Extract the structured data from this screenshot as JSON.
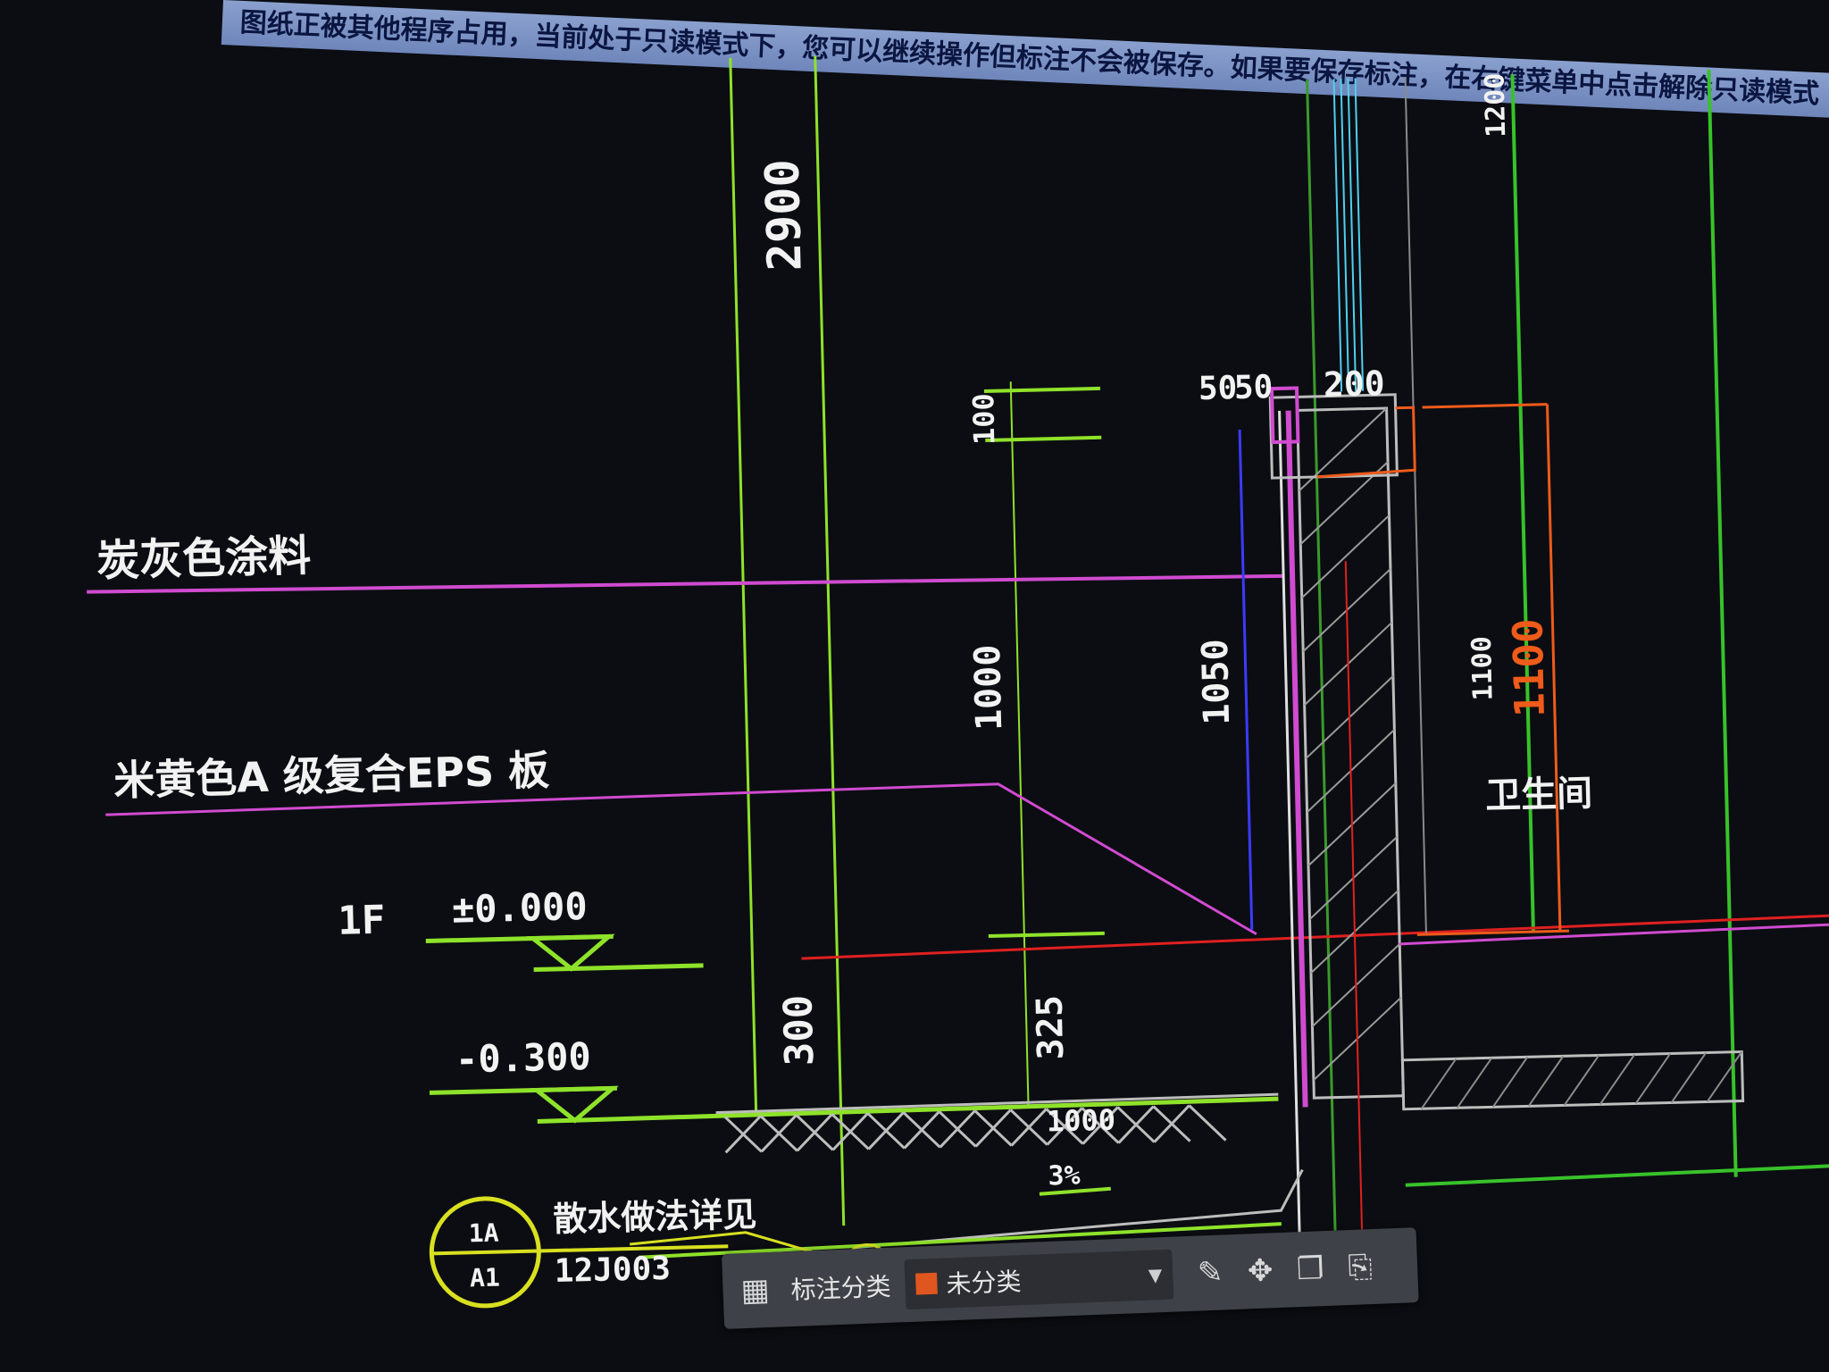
{
  "notification": {
    "text": "图纸正被其他程序占用，当前处于只读模式下，您可以继续操作但标注不会被保存。如果要保存标注，在右键菜单中点击解除只读模式"
  },
  "drawing": {
    "labels": {
      "charcoal_coating": "炭灰色涂料",
      "eps_board": "米黄色A 级复合EPS 板",
      "floor": "1F",
      "elev_zero": "±0.000",
      "elev_neg": "-0.300",
      "apron_note": "散水做法详见",
      "detail_top": "1A",
      "detail_bottom": "A1",
      "detail_ref": "12J003",
      "room": "卫生间",
      "slope": "3%"
    },
    "dimensions": {
      "d2900": "2900",
      "d100": "100",
      "d1000_vertical": "1000",
      "d300": "300",
      "d325": "325",
      "d1000_horizontal": "1000",
      "d50a": "50",
      "d50b": "50",
      "d200": "200",
      "d1050": "1050",
      "d1200": "1200",
      "d1100_white": "1100",
      "d1100_orange": "1100"
    }
  },
  "toolbar": {
    "category_label": "标注分类",
    "selected_category": "未分类",
    "swatch_color": "#e0561f",
    "icons": [
      "grid-icon",
      "edit-icon",
      "move-icon",
      "copy-icon",
      "paste-icon"
    ]
  },
  "colors": {
    "dim_green": "#8fe22a",
    "leader_magenta": "#d04bd0",
    "red_line": "#e02020",
    "orange_dim": "#ee5b1a",
    "blue_line": "#3b3bff"
  }
}
